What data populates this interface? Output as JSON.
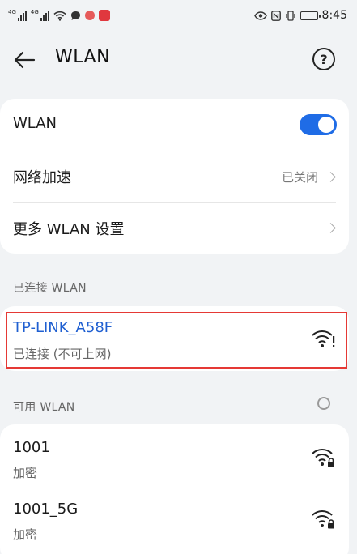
{
  "status_bar": {
    "sim1_tag": "4G",
    "sim2_tag": "4G",
    "time": "8:45",
    "icons": [
      "signal-icon",
      "signal-icon",
      "wifi-icon",
      "message-icon",
      "app-icon",
      "app-icon",
      "eye-icon",
      "nfc-icon",
      "vibrate-icon",
      "battery-icon"
    ]
  },
  "header": {
    "back_icon": "arrow-left-icon",
    "title": "WLAN",
    "help_symbol": "?"
  },
  "settings": {
    "wlan_label": "WLAN",
    "wlan_enabled": true,
    "network_acceleration_label": "网络加速",
    "network_acceleration_value": "已关闭",
    "more_settings_label": "更多 WLAN 设置"
  },
  "connected_section": {
    "title": "已连接 WLAN",
    "network": {
      "name": "TP-LINK_A58F",
      "status": "已连接 (不可上网)",
      "icon": "wifi-warning-icon"
    }
  },
  "available_section": {
    "title": "可用 WLAN",
    "networks": [
      {
        "name": "1001",
        "security": "加密",
        "icon": "wifi-locked-icon"
      },
      {
        "name": "1001_5G",
        "security": "加密",
        "icon": "wifi-locked-icon"
      }
    ]
  },
  "colors": {
    "accent": "#1f6ce6",
    "connected_text": "#1f5fd1",
    "highlight_border": "#e53935",
    "background": "#f1f3f5",
    "card": "#ffffff"
  }
}
